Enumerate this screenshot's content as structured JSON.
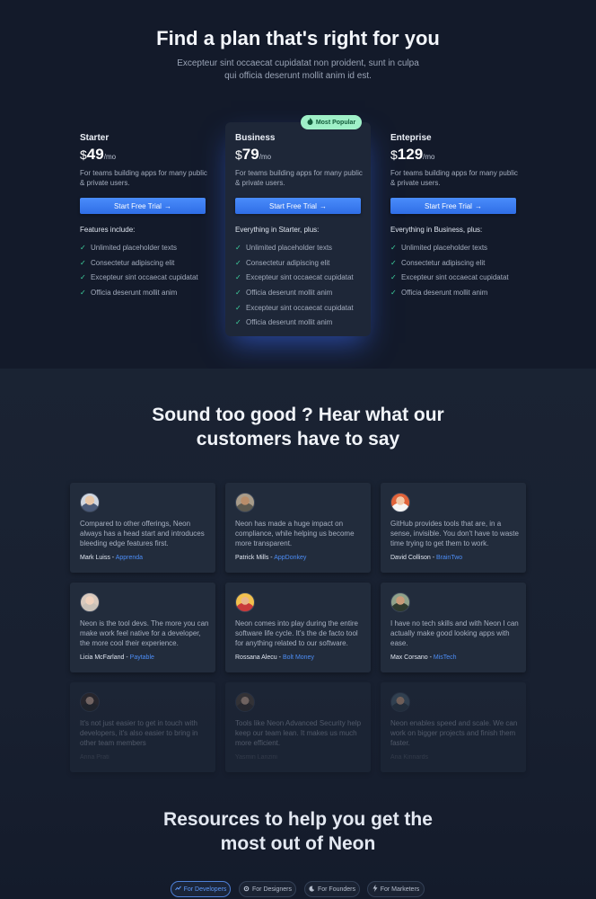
{
  "hero": {
    "title": "Find a plan that's right for you",
    "subtitle": "Excepteur sint occaecat cupidatat non proident, sunt in culpa qui officia deserunt mollit anim id est."
  },
  "plans": [
    {
      "name": "Starter",
      "currency": "$",
      "price": "49",
      "period": "/mo",
      "description": "For teams building apps for many public & private users.",
      "button": "Start Free Trial",
      "features_title": "Features include:",
      "features": [
        "Unlimited placeholder texts",
        "Consectetur adipiscing elit",
        "Excepteur sint occaecat cupidatat",
        "Officia deserunt mollit anim"
      ]
    },
    {
      "name": "Business",
      "currency": "$",
      "price": "79",
      "period": "/mo",
      "description": "For teams building apps for many public & private users.",
      "button": "Start Free Trial",
      "features_title": "Everything in Starter, plus:",
      "features": [
        "Unlimited placeholder texts",
        "Consectetur adipiscing elit",
        "Excepteur sint occaecat cupidatat",
        "Officia deserunt mollit anim",
        "Excepteur sint occaecat cupidatat",
        "Officia deserunt mollit anim"
      ]
    },
    {
      "name": "Enteprise",
      "currency": "$",
      "price": "129",
      "period": "/mo",
      "description": "For teams building apps for many public & private users.",
      "button": "Start Free Trial",
      "features_title": "Everything in Business, plus:",
      "features": [
        "Unlimited placeholder texts",
        "Consectetur adipiscing elit",
        "Excepteur sint occaecat cupidatat",
        "Officia deserunt mollit anim"
      ]
    }
  ],
  "badge": {
    "label": "Most Popular",
    "icon": "flame-icon"
  },
  "testimonials": {
    "title_line1": "Sound too good ? Hear what our",
    "title_line2": "customers have to say",
    "items": [
      {
        "quote": "Compared to other offerings, Neon always has a head start and introduces bleeding edge features first.",
        "name": "Mark Luiss",
        "company": "Apprenda"
      },
      {
        "quote": "Neon has made a huge impact on compliance, while helping us become more transparent.",
        "name": "Patrick Mills",
        "company": "AppDonkey"
      },
      {
        "quote": "GitHub provides tools that are, in a sense, invisible. You don't have to waste time trying to get them to work.",
        "name": "David Collison",
        "company": "BrainTwo"
      },
      {
        "quote": "Neon is the tool devs. The more you can make work feel native for a developer, the more cool their experience.",
        "name": "Licia McFarland",
        "company": "Paytable"
      },
      {
        "quote": "Neon comes into play during the entire software life cycle. It's the de facto tool for anything related to our software.",
        "name": "Rossana Alecu",
        "company": "Bolt Money"
      },
      {
        "quote": "I have no tech skills and with Neon I can actually make good looking apps with ease.",
        "name": "Max Corsano",
        "company": "MisTech"
      },
      {
        "quote": "It's not just easier to get in touch with developers, it's also easier to bring in other team members",
        "name": "Anna Prati",
        "company": ""
      },
      {
        "quote": "Tools like Neon Advanced Security help keep our team lean. It makes us much more efficient.",
        "name": "Yasmin Lanzini",
        "company": ""
      },
      {
        "quote": "Neon enables speed and scale. We can work on bigger projects and finish them faster.",
        "name": "Ana Kinnards",
        "company": ""
      }
    ]
  },
  "resources": {
    "title_line1": "Resources to help you get the",
    "title_line2": "most out of Neon",
    "tabs": [
      {
        "label": "For Developers",
        "icon": "trend-icon",
        "active": true
      },
      {
        "label": "For Designers",
        "icon": "gear-icon",
        "active": false
      },
      {
        "label": "For Founders",
        "icon": "moon-icon",
        "active": false
      },
      {
        "label": "For Marketers",
        "icon": "bolt-icon",
        "active": false
      }
    ]
  },
  "colors": {
    "accent": "#3b7cf0",
    "check": "#3fd6a0",
    "badge_bg": "#9ff0c8",
    "background": "#131a2a"
  }
}
